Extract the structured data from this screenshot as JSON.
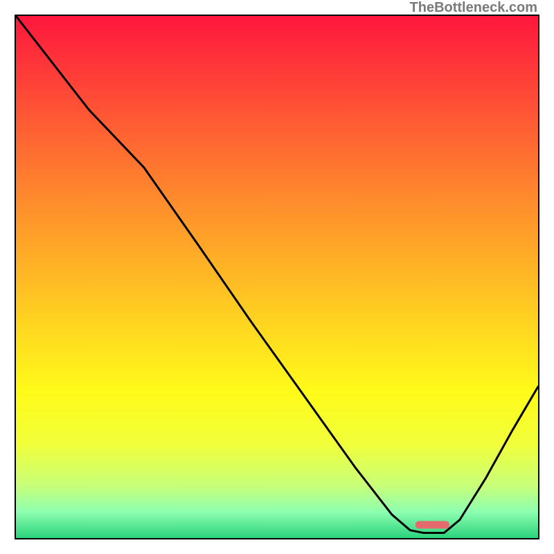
{
  "watermark": "TheBottleneck.com",
  "chart_data": {
    "type": "line",
    "title": "",
    "xlabel": "",
    "ylabel": "",
    "xlim": [
      0,
      100
    ],
    "ylim": [
      0,
      100
    ],
    "gradient_stops": [
      {
        "offset": 0.0,
        "color": "#ff173e"
      },
      {
        "offset": 0.2,
        "color": "#ff5a34"
      },
      {
        "offset": 0.4,
        "color": "#ff9a2a"
      },
      {
        "offset": 0.6,
        "color": "#ffd820"
      },
      {
        "offset": 0.72,
        "color": "#fffb1a"
      },
      {
        "offset": 0.82,
        "color": "#f1ff3a"
      },
      {
        "offset": 0.9,
        "color": "#c8ff7a"
      },
      {
        "offset": 0.95,
        "color": "#8dffb0"
      },
      {
        "offset": 1.0,
        "color": "#2bd27d"
      }
    ],
    "curve": [
      {
        "x": 0.0,
        "y": 100.0
      },
      {
        "x": 14.0,
        "y": 82.0
      },
      {
        "x": 24.5,
        "y": 71.0
      },
      {
        "x": 35.0,
        "y": 56.0
      },
      {
        "x": 45.0,
        "y": 41.5
      },
      {
        "x": 55.0,
        "y": 27.5
      },
      {
        "x": 65.0,
        "y": 13.5
      },
      {
        "x": 72.0,
        "y": 4.5
      },
      {
        "x": 75.5,
        "y": 1.5
      },
      {
        "x": 78.0,
        "y": 1.0
      },
      {
        "x": 82.0,
        "y": 1.0
      },
      {
        "x": 85.0,
        "y": 3.5
      },
      {
        "x": 90.0,
        "y": 11.5
      },
      {
        "x": 95.0,
        "y": 20.5
      },
      {
        "x": 100.0,
        "y": 29.0
      }
    ],
    "marker": {
      "x_start": 76.5,
      "x_end": 83.0,
      "y": 2.6,
      "color": "#e46a6e"
    }
  }
}
